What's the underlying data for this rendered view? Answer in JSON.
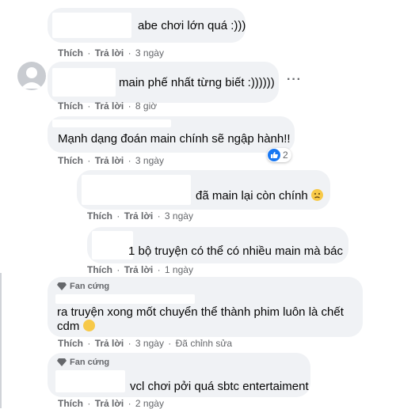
{
  "actions": {
    "like": "Thích",
    "reply": "Trả lời",
    "dot": "·",
    "edited": "Đã chỉnh sửa"
  },
  "more_dots": "···",
  "comments": [
    {
      "text": "abe chơi lớn quá :)))",
      "time": "3 ngày"
    },
    {
      "text": "main phế nhất từng biết :))))))",
      "time": "8 giờ"
    },
    {
      "text": "Mạnh dạng đoán main chính sẽ ngập hành!!",
      "time": "3 ngày",
      "reaction_count": "2"
    },
    {
      "text": "đã main lại còn chính",
      "time": "3 ngày",
      "emoji": "sad-face-emoji"
    },
    {
      "text": "1 bộ truyện có thể có nhiều main mà bác",
      "time": "1 ngày"
    },
    {
      "badge": "Fan cứng",
      "text_line1": "ra truyện xong mốt chuyển thể thành phim luôn là chết",
      "text_line2": "cdm",
      "emoji": "moon-face-emoji",
      "time": "3 ngày"
    },
    {
      "badge": "Fan cứng",
      "text": "vcl chơi pởi quá sbtc entertaiment",
      "time": "2 ngày"
    }
  ]
}
